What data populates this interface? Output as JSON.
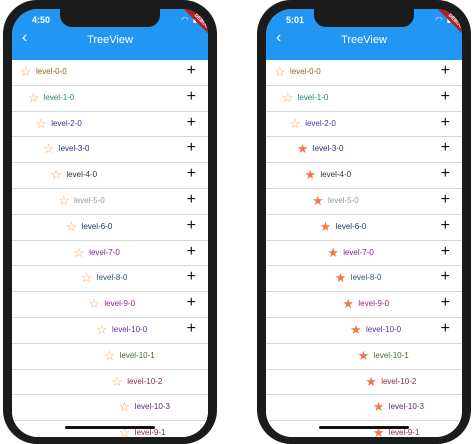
{
  "screens": [
    {
      "time": "4:50",
      "title": "TreeView",
      "debug": "DEBUG",
      "rows": [
        {
          "label": "level-0-0",
          "star": "☆",
          "star_color": "#f5a35a",
          "color": "#8a6d00",
          "plus": "+"
        },
        {
          "label": "level-1-0",
          "star": "☆",
          "star_color": "#f5a35a",
          "color": "#1e8a6a",
          "plus": "+"
        },
        {
          "label": "level-2-0",
          "star": "☆",
          "star_color": "#f5a35a",
          "color": "#4a2fa0",
          "plus": "+"
        },
        {
          "label": "level-3-0",
          "star": "☆",
          "star_color": "#f5a35a",
          "color": "#2b2b7a",
          "plus": "+"
        },
        {
          "label": "level-4-0",
          "star": "☆",
          "star_color": "#f5a35a",
          "color": "#333333",
          "plus": "+"
        },
        {
          "label": "level-5-0",
          "star": "☆",
          "star_color": "#f5a35a",
          "color": "#9a9a9a",
          "plus": "+"
        },
        {
          "label": "level-6-0",
          "star": "☆",
          "star_color": "#f5a35a",
          "color": "#1a3a6a",
          "plus": "+"
        },
        {
          "label": "level-7-0",
          "star": "☆",
          "star_color": "#f5a35a",
          "color": "#8a2090",
          "plus": "+"
        },
        {
          "label": "level-8-0",
          "star": "☆",
          "star_color": "#f5a35a",
          "color": "#2b5a7a",
          "plus": "+"
        },
        {
          "label": "level-9-0",
          "star": "☆",
          "star_color": "#f5a35a",
          "color": "#a01f8a",
          "plus": "+"
        },
        {
          "label": "level-10-0",
          "star": "☆",
          "star_color": "#f5a35a",
          "color": "#5a2fa0",
          "plus": "+"
        },
        {
          "label": "level-10-1",
          "star": "☆",
          "star_color": "#f5a35a",
          "color": "#4a6a2a",
          "plus": ""
        },
        {
          "label": "level-10-2",
          "star": "☆",
          "star_color": "#f5a35a",
          "color": "#8a2a4a",
          "plus": ""
        },
        {
          "label": "level-10-3",
          "star": "☆",
          "star_color": "#f5a35a",
          "color": "#5a2a6a",
          "plus": ""
        },
        {
          "label": "level-9-1",
          "star": "☆",
          "star_color": "#f5a35a",
          "color": "#8a2a4a",
          "plus": ""
        }
      ]
    },
    {
      "time": "5:01",
      "title": "TreeView",
      "debug": "DEBUG",
      "rows": [
        {
          "label": "level-0-0",
          "star": "☆",
          "star_color": "#f5a35a",
          "color": "#8a6d00",
          "plus": "+"
        },
        {
          "label": "level-1-0",
          "star": "☆",
          "star_color": "#f5a35a",
          "color": "#1e8a6a",
          "plus": "+"
        },
        {
          "label": "level-2-0",
          "star": "☆",
          "star_color": "#f5a35a",
          "color": "#4a2fa0",
          "plus": "+"
        },
        {
          "label": "level-3-0",
          "star": "★",
          "star_color": "#f07a45",
          "color": "#2b2b7a",
          "plus": "+"
        },
        {
          "label": "level-4-0",
          "star": "★",
          "star_color": "#f07a45",
          "color": "#333333",
          "plus": "+"
        },
        {
          "label": "level-5-0",
          "star": "★",
          "star_color": "#f07a45",
          "color": "#9a9a9a",
          "plus": "+"
        },
        {
          "label": "level-6-0",
          "star": "★",
          "star_color": "#f07a45",
          "color": "#1a3a6a",
          "plus": "+"
        },
        {
          "label": "level-7-0",
          "star": "★",
          "star_color": "#f07a45",
          "color": "#8a2090",
          "plus": "+"
        },
        {
          "label": "level-8-0",
          "star": "★",
          "star_color": "#f07a45",
          "color": "#2b5a7a",
          "plus": "+"
        },
        {
          "label": "level-9-0",
          "star": "★",
          "star_color": "#f07a45",
          "color": "#a01f8a",
          "plus": "+"
        },
        {
          "label": "level-10-0",
          "star": "★",
          "star_color": "#f07a45",
          "color": "#5a2fa0",
          "plus": "+"
        },
        {
          "label": "level-10-1",
          "star": "★",
          "star_color": "#f07a45",
          "color": "#4a6a2a",
          "plus": ""
        },
        {
          "label": "level-10-2",
          "star": "★",
          "star_color": "#f07a45",
          "color": "#8a2a4a",
          "plus": ""
        },
        {
          "label": "level-10-3",
          "star": "★",
          "star_color": "#f07a45",
          "color": "#5a2a6a",
          "plus": ""
        },
        {
          "label": "level-9-1",
          "star": "★",
          "star_color": "#f07a45",
          "color": "#8a2a4a",
          "plus": ""
        }
      ]
    }
  ]
}
